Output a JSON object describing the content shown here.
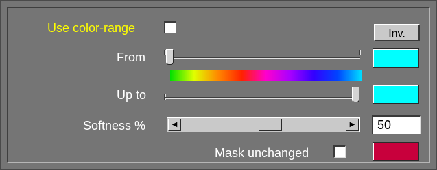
{
  "color_range": {
    "label": "Use color-range",
    "checked": false
  },
  "invert_button": {
    "label": "Inv."
  },
  "from": {
    "label": "From",
    "color": "#00ffff",
    "value_fraction": 0.0
  },
  "up_to": {
    "label": "Up to",
    "color": "#00ffff",
    "value_fraction": 1.0
  },
  "softness": {
    "label": "Softness %",
    "value": "50",
    "slider_fraction": 0.5
  },
  "mask_unchanged": {
    "label": "Mask unchanged",
    "checked": false,
    "color": "#c8003c"
  },
  "icons": {
    "scroll_left": "triangle-left-icon",
    "scroll_right": "triangle-right-icon"
  }
}
